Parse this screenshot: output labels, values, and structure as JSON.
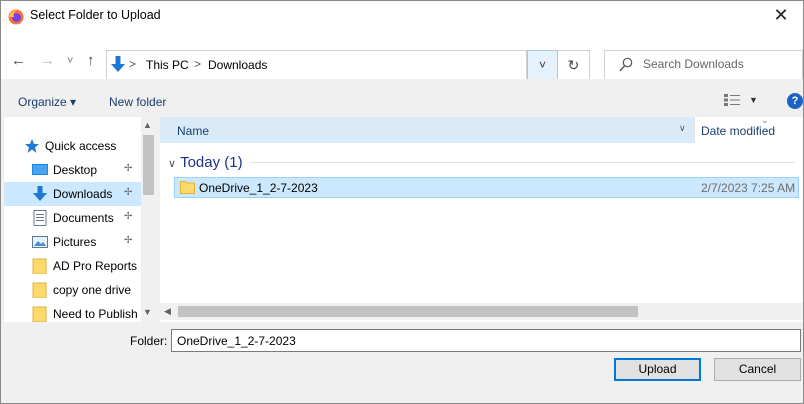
{
  "window": {
    "title": "Select Folder to Upload",
    "close_glyph": "✕"
  },
  "nav": {
    "back_glyph": "←",
    "forward_glyph": "→",
    "recent_glyph": "˅",
    "up_glyph": "↑",
    "breadcrumbs": [
      "This PC",
      "Downloads"
    ],
    "crumb_separator": ">",
    "dropdown_glyph": "˅",
    "refresh_glyph": "↻",
    "search_placeholder": "Search Downloads"
  },
  "toolbar": {
    "organize_label": "Organize ▾",
    "new_folder_label": "New folder",
    "view_dropdown_glyph": "▼",
    "help_glyph": "?"
  },
  "sidebar": {
    "items": [
      {
        "label": "Quick access",
        "icon": "star-icon",
        "pinned": false
      },
      {
        "label": "Desktop",
        "icon": "desktop-icon",
        "pinned": true
      },
      {
        "label": "Downloads",
        "icon": "download-icon",
        "pinned": true,
        "selected": true
      },
      {
        "label": "Documents",
        "icon": "document-icon",
        "pinned": true
      },
      {
        "label": "Pictures",
        "icon": "pictures-icon",
        "pinned": true
      },
      {
        "label": "AD Pro Reports",
        "icon": "folder-icon",
        "pinned": false
      },
      {
        "label": "copy one drive",
        "icon": "folder-icon",
        "pinned": false
      },
      {
        "label": "Need to Publish",
        "icon": "folder-icon",
        "pinned": false
      }
    ],
    "pin_glyph": "📌"
  },
  "filelist": {
    "columns": {
      "name": "Name",
      "date_modified": "Date modified"
    },
    "group_header": "Today (1)",
    "group_chevron": "∨",
    "rows": [
      {
        "name": "OneDrive_1_2-7-2023",
        "date_modified": "2/7/2023 7:25 AM",
        "selected": true
      }
    ]
  },
  "footer": {
    "folder_label": "Folder:",
    "folder_value": "OneDrive_1_2-7-2023",
    "upload_label": "Upload",
    "cancel_label": "Cancel"
  },
  "colors": {
    "selection": "#cce8ff",
    "selection_border": "#99d1ff",
    "accent": "#0078d7",
    "header_text": "#1a3e6c",
    "folder": "#ffd86b"
  }
}
